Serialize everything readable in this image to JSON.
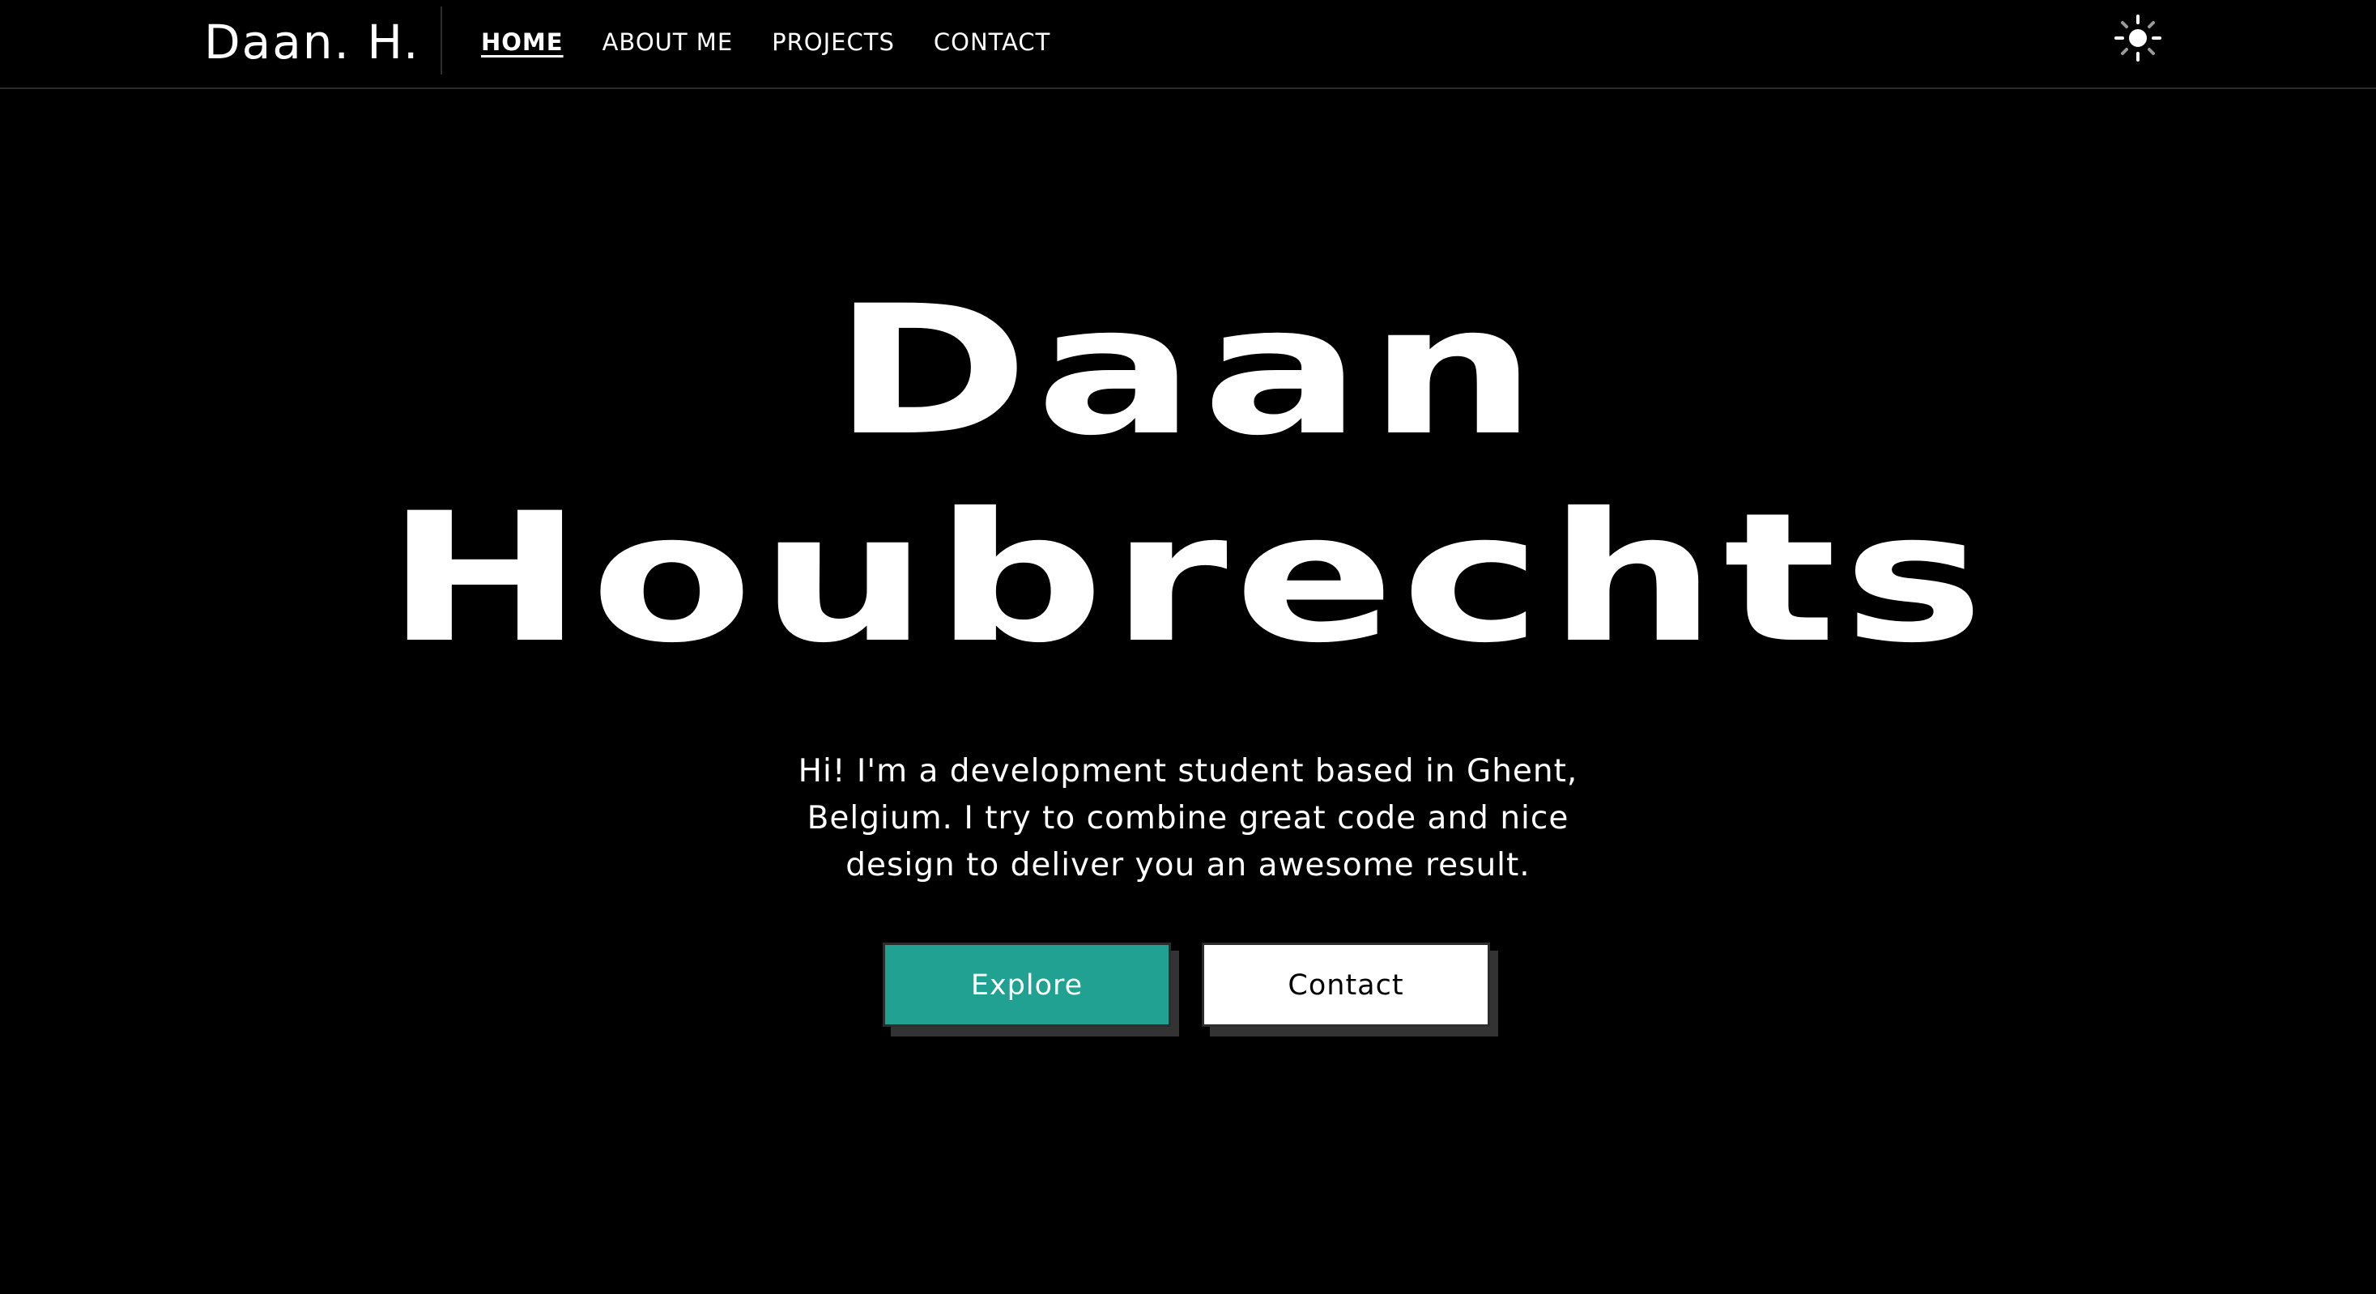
{
  "nav": {
    "brand": "Daan. H.",
    "links": [
      {
        "label": "HOME",
        "active": true
      },
      {
        "label": "ABOUT ME",
        "active": false
      },
      {
        "label": "PROJECTS",
        "active": false
      },
      {
        "label": "CONTACT",
        "active": false
      }
    ],
    "theme_toggle_icon": "sun-icon"
  },
  "hero": {
    "first_name": "Daan",
    "last_name": "Houbrechts",
    "description": "Hi! I'm a development student based in Ghent, Belgium. I try to combine great code and nice design to deliver you an awesome result.",
    "buttons": {
      "explore": "Explore",
      "contact": "Contact"
    }
  },
  "colors": {
    "background": "#000000",
    "text": "#ffffff",
    "accent": "#21a192"
  }
}
